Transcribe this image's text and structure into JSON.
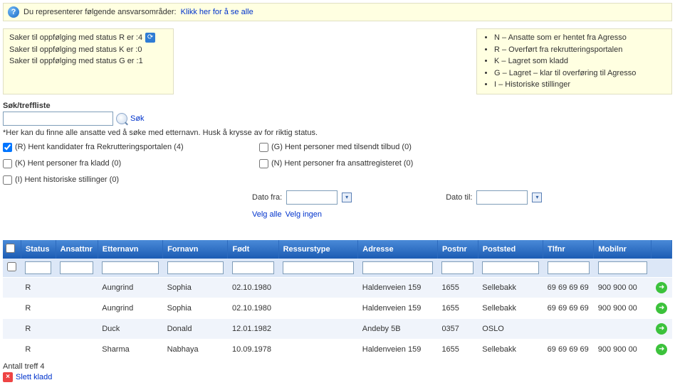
{
  "infoBar": {
    "text": "Du representerer følgende ansvarsområder:",
    "link": "Klikk her for å se alle"
  },
  "statusBox": {
    "line1": "Saker til oppfølging med status R er :4",
    "line2": "Saker til oppfølging med status K er :0",
    "line3": "Saker til oppfølging med status G er :1"
  },
  "legendBox": {
    "items": [
      "N – Ansatte som er hentet fra Agresso",
      "R – Overført fra rekrutteringsportalen",
      "K – Lagret som kladd",
      "G – Lagret – klar til overføring til Agresso",
      "I – Historiske stillinger"
    ]
  },
  "search": {
    "title": "Søk/treffliste",
    "button": "Søk",
    "hint": "*Her kan du finne alle ansatte ved å søke med etternavn. Husk å krysse av for riktig status.",
    "value": ""
  },
  "filters": {
    "r": {
      "label": "(R) Hent kandidater fra Rekrutteringsportalen (4)",
      "checked": true
    },
    "g": {
      "label": "(G) Hent personer med tilsendt tilbud (0)",
      "checked": false
    },
    "k": {
      "label": "(K) Hent personer fra kladd (0)",
      "checked": false
    },
    "n": {
      "label": "(N) Hent personer fra ansattregisteret (0)",
      "checked": false
    },
    "i": {
      "label": "(I) Hent historiske stillinger (0)",
      "checked": false
    }
  },
  "dates": {
    "fromLabel": "Dato fra:",
    "toLabel": "Dato til:",
    "from": "",
    "to": ""
  },
  "selectLinks": {
    "all": "Velg alle",
    "none": "Velg ingen"
  },
  "grid": {
    "headers": {
      "status": "Status",
      "ansattnr": "Ansattnr",
      "etternavn": "Etternavn",
      "fornavn": "Fornavn",
      "fodt": "Født",
      "ressurstype": "Ressurstype",
      "adresse": "Adresse",
      "postnr": "Postnr",
      "poststed": "Poststed",
      "tlfnr": "Tlfnr",
      "mobilnr": "Mobilnr"
    },
    "rows": [
      {
        "status": "R",
        "ansattnr": "",
        "etternavn": "Aungrind",
        "fornavn": "Sophia",
        "fodt": "02.10.1980",
        "ressurstype": "",
        "adresse": "Haldenveien 159",
        "postnr": "1655",
        "poststed": "Sellebakk",
        "tlfnr": "69 69 69 69",
        "mobilnr": "900 900 00"
      },
      {
        "status": "R",
        "ansattnr": "",
        "etternavn": "Aungrind",
        "fornavn": "Sophia",
        "fodt": "02.10.1980",
        "ressurstype": "",
        "adresse": "Haldenveien 159",
        "postnr": "1655",
        "poststed": "Sellebakk",
        "tlfnr": "69 69 69 69",
        "mobilnr": "900 900 00"
      },
      {
        "status": "R",
        "ansattnr": "",
        "etternavn": "Duck",
        "fornavn": "Donald",
        "fodt": "12.01.1982",
        "ressurstype": "",
        "adresse": "Andeby 5B",
        "postnr": "0357",
        "poststed": "OSLO",
        "tlfnr": "",
        "mobilnr": ""
      },
      {
        "status": "R",
        "ansattnr": "",
        "etternavn": "Sharma",
        "fornavn": "Nabhaya",
        "fodt": "10.09.1978",
        "ressurstype": "",
        "adresse": "Haldenveien 159",
        "postnr": "1655",
        "poststed": "Sellebakk",
        "tlfnr": "69 69 69 69",
        "mobilnr": "900 900 00"
      }
    ]
  },
  "footer": {
    "count": "Antall treff 4",
    "delete": "Slett kladd"
  }
}
